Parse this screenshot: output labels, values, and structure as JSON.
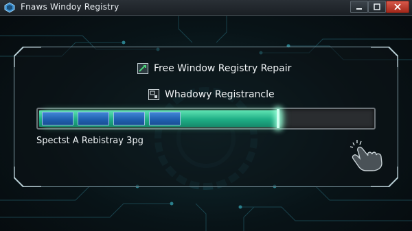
{
  "window": {
    "title": "Fnaws Windoy Registry",
    "controls": {
      "minimize": "–",
      "maximize": "□",
      "close": "✕"
    }
  },
  "panel": {
    "heading": "Free Window Registry Repair",
    "heading_icon": "repair-icon",
    "subheading": "Whadowy Registrancle",
    "subheading_icon": "registry-icon"
  },
  "progress": {
    "fraction": 0.72,
    "segments_filled": 4,
    "status": "Spectst A Rebistray 3pg"
  },
  "colors": {
    "accent": "#1fae86",
    "segment": "#2f72c4",
    "close": "#c3402f"
  },
  "icons": {
    "app": "app-icon",
    "hand": "hand-click-icon"
  }
}
